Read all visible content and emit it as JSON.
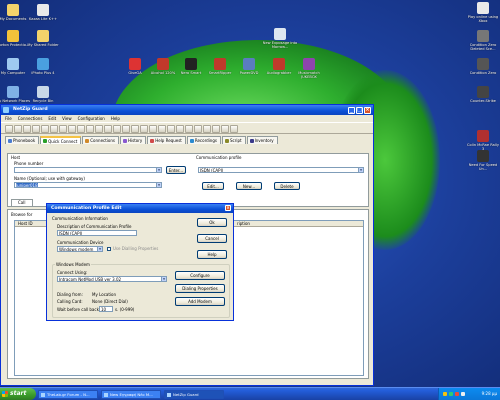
{
  "desktop": {
    "icons_left": [
      {
        "label": "My Documents",
        "color": "#f3d36b"
      },
      {
        "label": "Kazaa Lite K++",
        "color": "#e9e9e9"
      },
      {
        "label": "Norton Protectio...",
        "color": "#f2c23a"
      },
      {
        "label": "My Shared Folder",
        "color": "#f3d36b"
      },
      {
        "label": "My Computer",
        "color": "#9ec9f0"
      },
      {
        "label": "iPhoto Plus 4",
        "color": "#4aa0e0"
      },
      {
        "label": "My Network Places",
        "color": "#7fb1e6"
      },
      {
        "label": "Recycle Bin",
        "color": "#c8d8e8"
      }
    ],
    "icons_top": [
      {
        "label": "GiveGA",
        "color": "#d33"
      },
      {
        "label": "Alcohol 120%",
        "color": "#c0392b"
      },
      {
        "label": "Nero Smart",
        "color": "#222"
      },
      {
        "label": "SmartRipper",
        "color": "#c0392b"
      },
      {
        "label": "PowerDVD",
        "color": "#5b7cc0"
      },
      {
        "label": "Audiograbber",
        "color": "#c0392b"
      },
      {
        "label": "Musicmatch JUKEBOX",
        "color": "#8e44ad"
      }
    ],
    "icon_center": {
      "label": "New Exposage into Morrow...",
      "color": "#dde6f0"
    },
    "icons_right": [
      {
        "label": "Play online using Xbox",
        "color": "#e9e9e9"
      },
      {
        "label": "Condition Zero Deleted Sce...",
        "color": "#777"
      },
      {
        "label": "Condition Zero",
        "color": "#555"
      },
      {
        "label": "Counter-Strike",
        "color": "#444"
      },
      {
        "label": "Colin McRae Rally 3",
        "color": "#b03030"
      },
      {
        "label": "Need For Speed Un...",
        "color": "#333"
      }
    ]
  },
  "netsup_window": {
    "title": "NetZip Guard",
    "menu": [
      "File",
      "Connections",
      "Edit",
      "View",
      "Configuration",
      "Help"
    ],
    "tabs": [
      {
        "label": "Phonebook",
        "color": "#4a7cd0",
        "active": false
      },
      {
        "label": "Quick Connect",
        "color": "#2aa02a",
        "active": true
      },
      {
        "label": "Connections",
        "color": "#d08a2a",
        "active": false
      },
      {
        "label": "History",
        "color": "#8a5ad0",
        "active": false
      },
      {
        "label": "Help Request",
        "color": "#d04a4a",
        "active": false
      },
      {
        "label": "Recordings",
        "color": "#2a8ad0",
        "active": false
      },
      {
        "label": "Script",
        "color": "#8a8a2a",
        "active": false
      },
      {
        "label": "Inventory",
        "color": "#3a3a8a",
        "active": false
      }
    ],
    "host_group": "Host",
    "phone_label": "Phone number",
    "enter_button": "Enter...",
    "name_label": "Name (Optional; use with gateway)",
    "name_value": "Juniper018",
    "profile_group": "Communication profile",
    "profile_value": "ISDN (CAPI)",
    "edit_button": "Edit...",
    "new_button": "New...",
    "delete_button": "Delete",
    "call_tab": "Call",
    "browse_label": "Browse for",
    "host_id_col": "Host ID",
    "description_col": "ription"
  },
  "profile_dialog": {
    "title": "Communication Profile Edit",
    "info_group": "Communication Information",
    "desc_label": "Description of Communication Profile",
    "desc_value": "ISDN (CAPI)",
    "device_label": "Communication Device",
    "device_value": "Windows modem",
    "checkbox_label": "Use Dialling Properties",
    "ok_button": "Ok",
    "cancel_button": "Cancel",
    "help_button": "Help",
    "modem_group": "Windows Modem",
    "connect_label": "Connect Using:",
    "connect_value": "Intracom NetMod USB ver 3.02",
    "configure_button": "Configure",
    "dialing_props_button": "Dialing Properties",
    "add_modem_button": "Add Modem",
    "dialing_from_label": "Dialing from:",
    "dialing_from_value": "My Location",
    "calling_card_label": "Calling Card:",
    "calling_card_value": "None (Direct Dial)",
    "wait_label": "Wait before call back:",
    "wait_value": "10",
    "wait_unit": "s. (0-999)"
  },
  "taskbar": {
    "start_label": "start",
    "tasks": [
      {
        "label": "TheLab.gr Forum - N...",
        "active": false
      },
      {
        "label": "New Εγγραφή Νέο Μ...",
        "active": false
      },
      {
        "label": "NetZip Guard",
        "active": true
      }
    ],
    "clock": "9:28 μμ",
    "tray_colors": [
      "#f1c40f",
      "#2ecc71",
      "#e74c3c",
      "#ecf0f1"
    ]
  }
}
